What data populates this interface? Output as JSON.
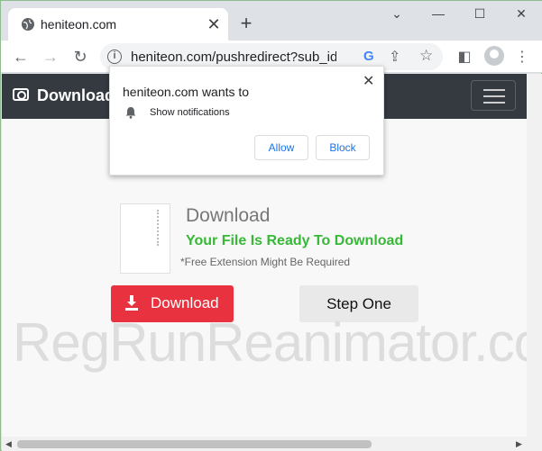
{
  "tab": {
    "title": "heniteon.com"
  },
  "omnibox": {
    "url": "heniteon.com/pushredirect?sub_id"
  },
  "site": {
    "brand": "Download",
    "heading": "Download",
    "ready": "Your File Is Ready To Download",
    "note": "*Free Extension Might Be Required",
    "download_label": "Download",
    "step_label": "Step One"
  },
  "watermark": "RegRunReanimator.com",
  "popup": {
    "title": "heniteon.com wants to",
    "permission": "Show notifications",
    "allow_label": "Allow",
    "block_label": "Block"
  },
  "colors": {
    "accent_red": "#e8323f",
    "ready_green": "#37b837",
    "navbar": "#343a40"
  }
}
